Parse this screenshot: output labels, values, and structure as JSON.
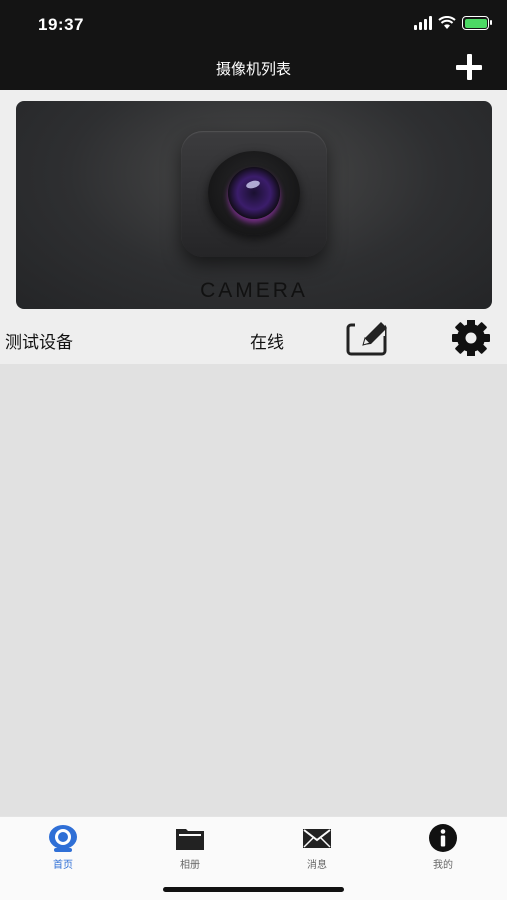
{
  "status_bar": {
    "time": "19:37",
    "battery_color": "#4cd964"
  },
  "nav": {
    "title": "摄像机列表",
    "add_icon": "plus-icon"
  },
  "device": {
    "image_label": "CAMERA",
    "name": "测试设备",
    "status": "在线",
    "edit_icon": "edit-icon",
    "settings_icon": "gear-icon"
  },
  "tabs": [
    {
      "label": "首页",
      "icon": "camera-icon",
      "active": true
    },
    {
      "label": "相册",
      "icon": "folder-icon",
      "active": false
    },
    {
      "label": "消息",
      "icon": "envelope-icon",
      "active": false
    },
    {
      "label": "我的",
      "icon": "info-icon",
      "active": false
    }
  ],
  "colors": {
    "accent": "#2f6fd6",
    "header_bg": "#141414",
    "page_bg": "#e1e1e1"
  }
}
